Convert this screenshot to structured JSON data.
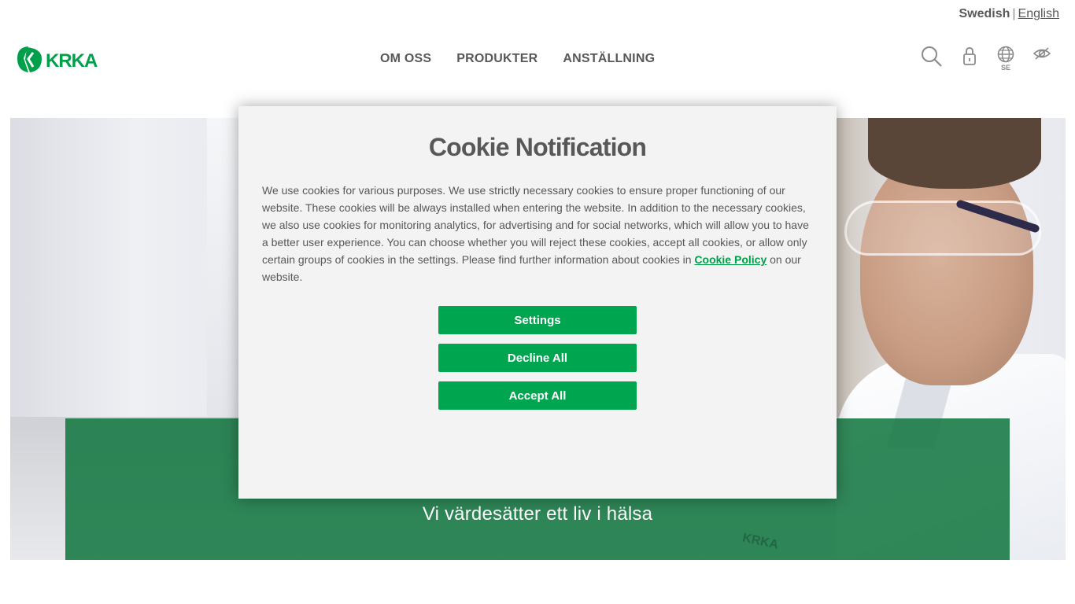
{
  "lang_bar": {
    "current": "Swedish",
    "separator": "|",
    "other": "English"
  },
  "logo": {
    "text": "KRKA"
  },
  "nav": {
    "items": [
      {
        "label": "OM OSS"
      },
      {
        "label": "PRODUKTER"
      },
      {
        "label": "ANSTÄLLNING"
      }
    ]
  },
  "tools": {
    "search_icon": "search-icon",
    "lock_icon": "lock-icon",
    "globe_icon": "globe-icon",
    "country_code": "SE",
    "visibility_icon": "eye-slash-icon"
  },
  "hero": {
    "tagline": "Vi värdesätter ett liv i hälsa",
    "watermark": "KRKA"
  },
  "cookie_modal": {
    "title": "Cookie Notification",
    "body_text": "We use cookies for various purposes. We use strictly necessary cookies to ensure proper functioning of our website. These cookies will be always installed when entering the website. In addition to the necessary cookies, we also use cookies for monitoring analytics, for advertising and for social networks, which will allow you to have a better user experience. You can choose whether you will reject these cookies, accept all cookies, or allow only certain groups of cookies in the settings. Please find further information about cookies in ",
    "policy_link": "Cookie Policy",
    "body_suffix": " on our website.",
    "buttons": {
      "settings": "Settings",
      "decline": "Decline All",
      "accept": "Accept All"
    }
  },
  "colors": {
    "brand_green": "#00a64f",
    "band_green": "#157842",
    "text_gray": "#585858",
    "modal_bg": "#f3f3f3"
  }
}
